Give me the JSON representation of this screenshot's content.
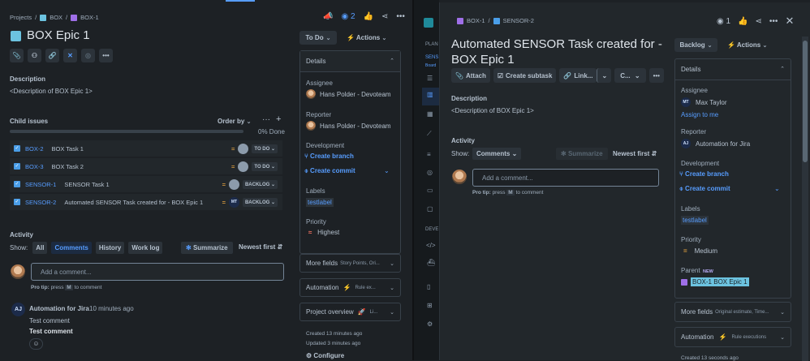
{
  "left": {
    "breadcrumb": [
      "Projects",
      "BOX",
      "BOX-1"
    ],
    "watch_count": "2",
    "title": "BOX Epic 1",
    "description_label": "Description",
    "description": "<Description of BOX Epic 1>",
    "child_issues_label": "Child issues",
    "order_by": "Order by",
    "progress_text": "0% Done",
    "progress_pct": 0,
    "children": [
      {
        "key": "BOX-2",
        "summary": "BOX Task 1",
        "status": "TO DO",
        "assignee": ""
      },
      {
        "key": "BOX-3",
        "summary": "BOX Task 2",
        "status": "TO DO",
        "assignee": ""
      },
      {
        "key": "SENSOR-1",
        "summary": "SENSOR Task 1",
        "status": "BACKLOG",
        "assignee": ""
      },
      {
        "key": "SENSOR-2",
        "summary": "Automated SENSOR Task created for - BOX Epic 1",
        "status": "BACKLOG",
        "assignee": "MT"
      }
    ],
    "activity_label": "Activity",
    "show_label": "Show:",
    "filters": [
      "All",
      "Comments",
      "History",
      "Work log"
    ],
    "summarize": "Summarize",
    "sort": "Newest first",
    "comment_placeholder": "Add a comment...",
    "pro_tip": {
      "a": "Pro tip:",
      "b": "press",
      "key": "M",
      "c": "to comment"
    },
    "comment": {
      "initials": "AJ",
      "author": "Automation for Jira",
      "time": "10 minutes ago",
      "line1": "Test comment",
      "line2": "Test comment"
    },
    "status_button": "To Do",
    "actions": "Actions",
    "details": {
      "title": "Details",
      "assignee_label": "Assignee",
      "assignee": "Hans Polder - Devoteam",
      "reporter_label": "Reporter",
      "reporter": "Hans Polder - Devoteam",
      "development_label": "Development",
      "create_branch": "Create branch",
      "create_commit": "Create commit",
      "labels_label": "Labels",
      "label": "testlabel",
      "priority_label": "Priority",
      "priority": "Highest"
    },
    "more_fields": "More fields",
    "more_fields_hint": "Story Points, Ori...",
    "automation": "Automation",
    "automation_hint": "Rule ex...",
    "project_overview": "Project overview",
    "project_overview_hint": "Li...",
    "created": "Created 13 minutes ago",
    "updated": "Updated 3 minutes ago",
    "configure": "Configure"
  },
  "sidebar": {
    "planning": "PLAN",
    "sens": "SENS",
    "board": "Board",
    "dev": "DEVE"
  },
  "modal": {
    "breadcrumb": [
      "BOX-1",
      "SENSOR-2"
    ],
    "watch_count": "1",
    "title": "Automated SENSOR Task created for - BOX Epic 1",
    "toolbar": [
      "Attach",
      "Create subtask",
      "Link...",
      "C..."
    ],
    "description_label": "Description",
    "description": "<Description of BOX Epic 1>",
    "activity_label": "Activity",
    "show_label": "Show:",
    "filter": "Comments",
    "summarize": "Summarize",
    "sort": "Newest first",
    "comment_placeholder": "Add a comment...",
    "pro_tip": {
      "a": "Pro tip:",
      "b": "press",
      "key": "M",
      "c": "to comment"
    },
    "status_button": "Backlog",
    "actions": "Actions",
    "details": {
      "title": "Details",
      "assignee_label": "Assignee",
      "assignee_initials": "MT",
      "assignee": "Max Taylor",
      "assign_to_me": "Assign to me",
      "reporter_label": "Reporter",
      "reporter_initials": "AJ",
      "reporter": "Automation for Jira",
      "development_label": "Development",
      "create_branch": "Create branch",
      "create_commit": "Create commit",
      "labels_label": "Labels",
      "label": "testlabel",
      "priority_label": "Priority",
      "priority": "Medium",
      "parent_label": "Parent",
      "parent_badge": "NEW",
      "parent": "BOX-1 BOX Epic 1"
    },
    "more_fields": "More fields",
    "more_fields_hint": "Original estimate, Time...",
    "automation": "Automation",
    "automation_hint": "Rule executions",
    "created": "Created 13 seconds ago"
  },
  "colors": {
    "accent": "#579dff",
    "bg": "#1d2125",
    "modal": "#22272b",
    "epic": "#6cc3e0",
    "priority_medium": "#e2a03f",
    "priority_high": "#f87462"
  }
}
